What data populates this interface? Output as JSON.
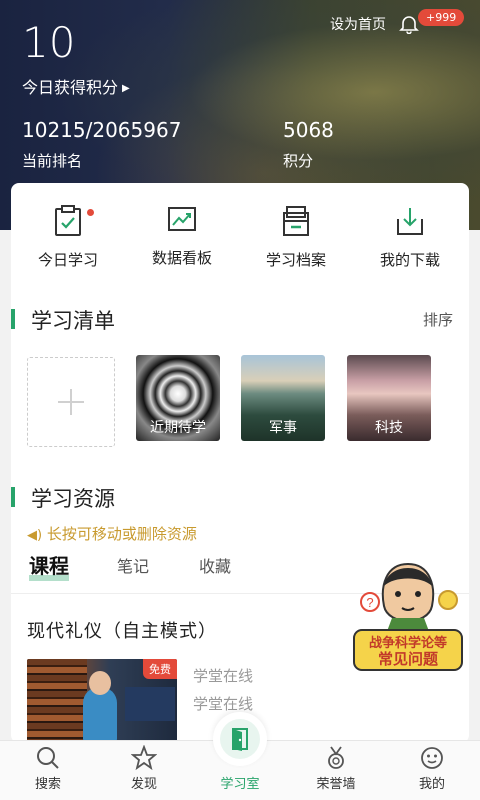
{
  "header": {
    "today_points": "10",
    "today_points_label": "今日获得积分",
    "set_home": "设为首页",
    "notification_badge": "+999",
    "rank_value": "10215/2065967",
    "rank_label": "当前排名",
    "total_points_value": "5068",
    "total_points_label": "积分"
  },
  "quick_actions": [
    {
      "label": "今日学习",
      "icon": "clipboard-check-icon",
      "has_dot": true
    },
    {
      "label": "数据看板",
      "icon": "chart-board-icon",
      "has_dot": false
    },
    {
      "label": "学习档案",
      "icon": "folder-archive-icon",
      "has_dot": false
    },
    {
      "label": "我的下载",
      "icon": "download-tray-icon",
      "has_dot": false
    }
  ],
  "study_list": {
    "title": "学习清单",
    "sort_label": "排序",
    "tiles": [
      {
        "label": "近期待学"
      },
      {
        "label": "军事"
      },
      {
        "label": "科技"
      }
    ]
  },
  "resources": {
    "title": "学习资源",
    "tip": "长按可移动或删除资源",
    "tabs": [
      {
        "label": "课程",
        "active": true
      },
      {
        "label": "笔记",
        "active": false
      },
      {
        "label": "收藏",
        "active": false
      }
    ],
    "course": {
      "title": "现代礼仪（自主模式）",
      "badge": "免费",
      "source_1": "学堂在线",
      "source_2": "学堂在线"
    }
  },
  "faq_sticker": {
    "line1": "战争科学论等",
    "line2": "常见问题"
  },
  "bottom_nav": [
    {
      "label": "搜索",
      "icon": "search-icon"
    },
    {
      "label": "发现",
      "icon": "star-icon"
    },
    {
      "label": "学习室",
      "icon": "door-icon",
      "active": true
    },
    {
      "label": "荣誉墙",
      "icon": "medal-icon"
    },
    {
      "label": "我的",
      "icon": "profile-icon"
    }
  ],
  "colors": {
    "accent": "#27a36a",
    "badge_red": "#e34a3a",
    "tip_gold": "#c89a2f"
  }
}
